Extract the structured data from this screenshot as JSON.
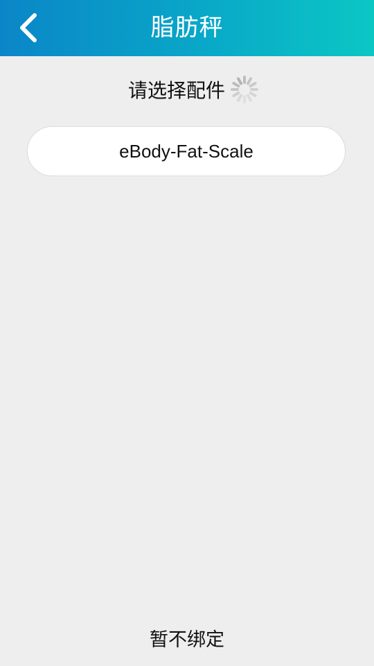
{
  "header": {
    "title": "脂肪秤",
    "back_icon": "chevron-left-icon"
  },
  "accessory_select": {
    "label": "请选择配件",
    "loading_icon": "loading-spinner-icon"
  },
  "devices": [
    {
      "name": "eBody-Fat-Scale"
    }
  ],
  "footer": {
    "skip_label": "暂不绑定"
  },
  "colors": {
    "header_start": "#0a86c8",
    "header_end": "#0bc7c4",
    "background": "#eeeeee",
    "card": "#ffffff"
  }
}
